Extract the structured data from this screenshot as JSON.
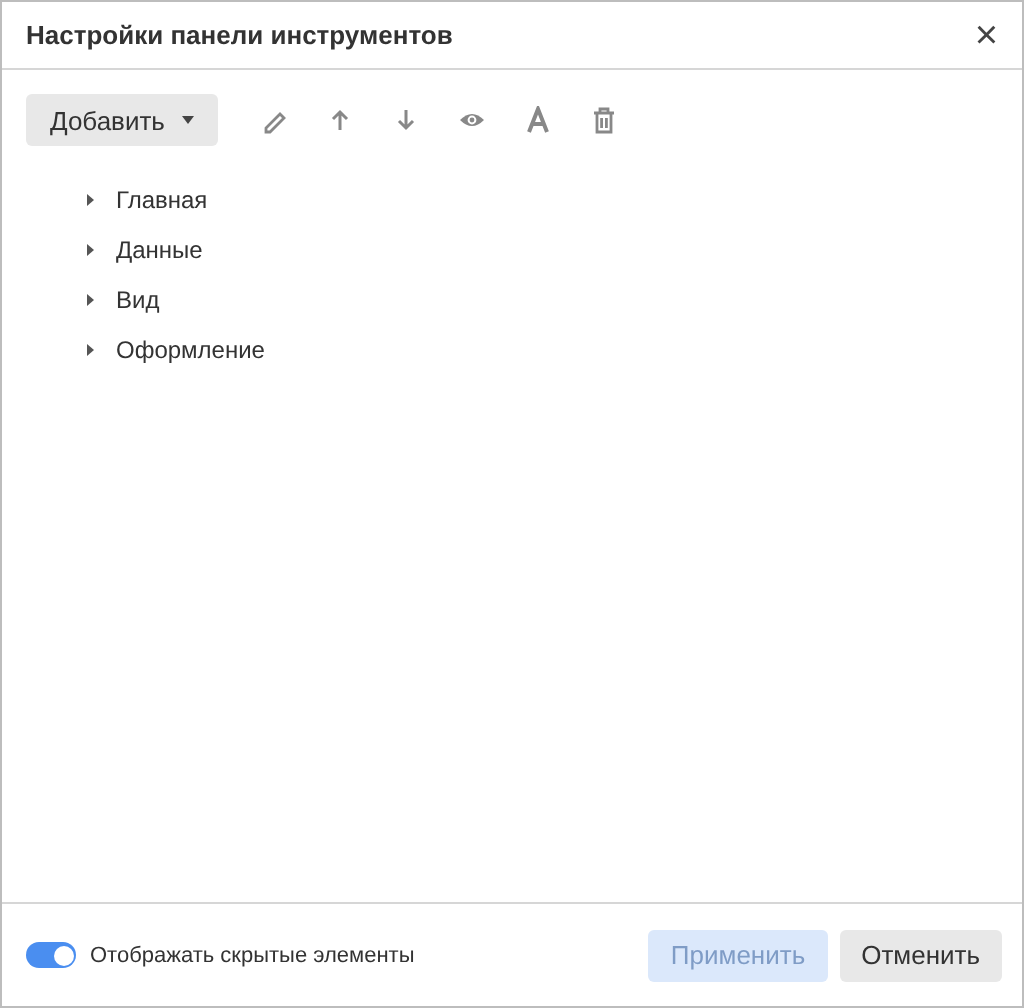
{
  "window": {
    "title": "Настройки панели инструментов",
    "close": "×"
  },
  "toolbar": {
    "add_button": {
      "label": "Добавить"
    }
  },
  "tree": {
    "items": [
      {
        "label": "Главная",
        "expanded": false
      },
      {
        "label": "Данные",
        "expanded": false
      },
      {
        "label": "Вид",
        "expanded": false
      },
      {
        "label": "Оформление",
        "expanded": false
      }
    ]
  },
  "footer": {
    "show_hidden": {
      "label": "Отображать скрытые элементы",
      "on": true
    },
    "buttons": [
      {
        "label": "Применить",
        "disabled": true
      },
      {
        "label": "Отменить",
        "disabled": false
      }
    ]
  }
}
